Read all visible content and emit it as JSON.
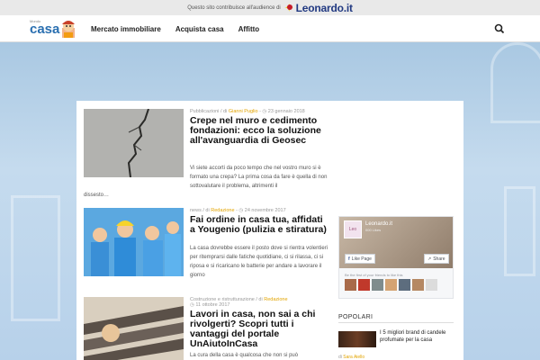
{
  "topbar": {
    "promo_text": "Questo sito contribuisce all'audience di",
    "partner_name": "Leonardo.it"
  },
  "header": {
    "logo_small": "Mondo",
    "logo_text": "casa",
    "nav": [
      "Mercato immobiliare",
      "Acquista casa",
      "Affitto"
    ],
    "search_icon": "search-icon"
  },
  "posts": [
    {
      "category": "Pubblicazioni",
      "sep": " / di ",
      "author": "Gianni Puglio",
      "date": " - ◷ 23 gennaio 2018",
      "title": "Crepe nel muro e cedimento fondazioni: ecco la soluzione all'avanguardia di Geosec",
      "excerpt": "Vi siete accorti da poco tempo che nel vostro muro si è formato una crepa? La prima cosa da fare è quella di non sottovalutare il problema, altrimenti il",
      "more": "dissesto…"
    },
    {
      "category": "news",
      "sep": " / di ",
      "author": "Redazione",
      "date": " - ◷ 24 novembre 2017",
      "title": "Fai ordine in casa tua, affidati a Yougenio (pulizia e stiratura)",
      "excerpt": "La casa dovrebbe essere il posto dove si rientra volentieri per ritemprarsi dalle fatiche quotidiane, ci si rilassa, ci si riposa e si ricaricano le batterie per andare a lavorare il giorno"
    },
    {
      "category": "Costruzione e ristrutturazione",
      "sep": " / di ",
      "author": "Redazione",
      "date": "◷ 11 ottobre 2017",
      "title": "Lavori in casa, non sai a chi rivolgerti? Scopri tutti i vantaggi del portale UnAiutoInCasa",
      "excerpt": "La cura della casa è qualcosa che non si può"
    }
  ],
  "facebook": {
    "page_name": "Leonardo.it",
    "followers": "000 Likes",
    "like_page": "Like Page",
    "share": "Share",
    "friends_text": "Be the first of your friends to like this",
    "pic_label": "Leo"
  },
  "sidebar": {
    "popolari_label": "POPOLARI",
    "popular_title": "I 5 migliori brand di candele profumate per la casa",
    "popular_author": "Sara Aiello",
    "popular_prefix": "di "
  },
  "colors": {
    "accent": "#e2a400",
    "nav_text": "#222222",
    "brand_blue": "#2a6fb0",
    "leonardo_blue": "#223a82"
  }
}
